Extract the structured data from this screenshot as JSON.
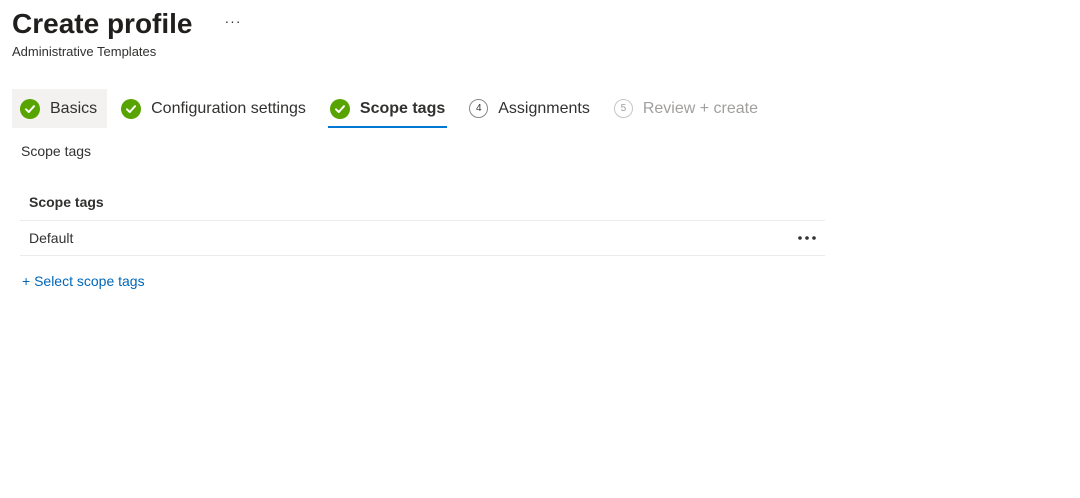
{
  "header": {
    "title": "Create profile",
    "subtitle": "Administrative Templates",
    "more_label": "···"
  },
  "wizard": {
    "steps": [
      {
        "label": "Basics",
        "state": "complete"
      },
      {
        "label": "Configuration settings",
        "state": "complete"
      },
      {
        "label": "Scope tags",
        "state": "active"
      },
      {
        "label": "Assignments",
        "state": "pending",
        "number": "4"
      },
      {
        "label": "Review + create",
        "state": "disabled",
        "number": "5"
      }
    ]
  },
  "section": {
    "label": "Scope tags"
  },
  "grid": {
    "column_header": "Scope tags",
    "rows": [
      {
        "name": "Default"
      }
    ]
  },
  "actions": {
    "select_scope_tags": "+ Select scope tags"
  },
  "colors": {
    "accent": "#0078d4",
    "link": "#0067b8",
    "success": "#57a300"
  }
}
